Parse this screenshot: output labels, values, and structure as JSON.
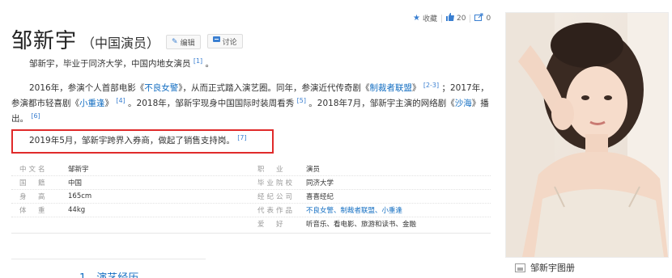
{
  "actions": {
    "collect_label": "收藏",
    "like_count": "20",
    "share_count": "0"
  },
  "header": {
    "title": "邹新宇",
    "subtitle": "（中国演员）",
    "edit_label": "编辑",
    "discuss_label": "讨论"
  },
  "intro": {
    "text": "邹新宇，毕业于同济大学，中国内地女演员",
    "ref": "[1]",
    "tail": "。"
  },
  "career": {
    "line1_a": "2016年，参演个人首部电影《",
    "film1": "不良女警",
    "line1_b": "》，从而正式踏入演艺圈。同年，参演近代传奇剧《",
    "drama1": "制裁者联盟",
    "line1_c": "》",
    "ref1": "[2-3]",
    "line1_d": "；2017年，",
    "line2_a": "参演都市轻喜剧《",
    "drama2": "小重逢",
    "line2_b": "》",
    "ref2": "[4]",
    "line2_c": "。2018年，邹新宇现身中国国际时装周看秀",
    "ref3": "[5]",
    "line2_d": "。2018年7月，邹新宇主演的网络剧《",
    "drama3": "沙海",
    "line2_e": "》播",
    "line3_a": "出。",
    "ref4": "[6]"
  },
  "highlight": {
    "text": "2019年5月，邹新宇跨界入券商，做起了销售支持岗。",
    "ref": "[7]"
  },
  "infobox": {
    "left": [
      {
        "key": "中文名",
        "value": "邹新宇"
      },
      {
        "key": "国　籍",
        "value": "中国"
      },
      {
        "key": "身　高",
        "value": "165cm"
      },
      {
        "key": "体　重",
        "value": "44kg"
      }
    ],
    "right": [
      {
        "key": "职　业",
        "value": "演员"
      },
      {
        "key": "毕业院校",
        "value": "同济大学"
      },
      {
        "key": "经纪公司",
        "value": "喜喜经纪"
      },
      {
        "key": "代表作品",
        "value": "不良女警、制裁者联盟、小重逢"
      },
      {
        "key": "爱　好",
        "value": "听音乐、看电影、旅游和读书、金融"
      }
    ]
  },
  "toc": {
    "first_item": "1　演艺经历"
  },
  "album": {
    "label": "邹新宇图册"
  }
}
